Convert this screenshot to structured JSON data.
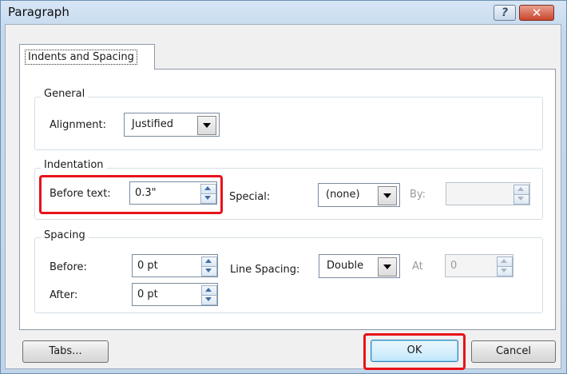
{
  "window": {
    "title": "Paragraph",
    "help_glyph": "?",
    "close_glyph": "✕"
  },
  "tab": {
    "label": "Indents and Spacing"
  },
  "general": {
    "legend": "General",
    "alignment_label": "Alignment:",
    "alignment_value": "Justified"
  },
  "indentation": {
    "legend": "Indentation",
    "before_text_label": "Before text:",
    "before_text_value": "0.3\"",
    "special_label": "Special:",
    "special_value": "(none)",
    "by_label": "By:",
    "by_value": ""
  },
  "spacing": {
    "legend": "Spacing",
    "before_label": "Before:",
    "before_value": "0 pt",
    "after_label": "After:",
    "after_value": "0 pt",
    "line_spacing_label": "Line Spacing:",
    "line_spacing_value": "Double",
    "at_label": "At",
    "at_value": "0"
  },
  "buttons": {
    "tabs": "Tabs...",
    "ok": "OK",
    "cancel": "Cancel"
  },
  "annotations": {
    "highlight_color": "#e8121a"
  }
}
